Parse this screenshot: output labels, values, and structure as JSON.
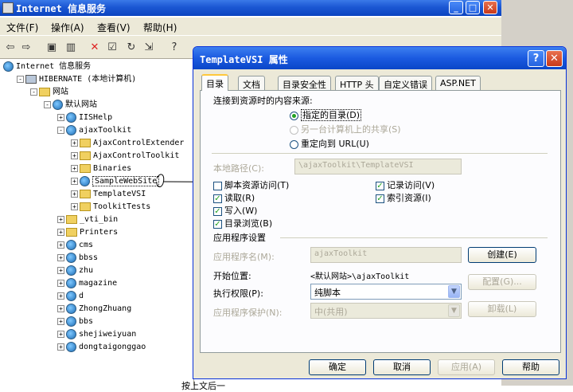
{
  "main_window": {
    "title": "Internet 信息服务",
    "menu": [
      "文件(F)",
      "操作(A)",
      "查看(V)",
      "帮助(H)"
    ]
  },
  "tree": [
    {
      "label": "Internet 信息服务",
      "icon": "iis-icon",
      "indent": 0,
      "exp": ""
    },
    {
      "label": "HIBERNATE (本地计算机)",
      "icon": "computer-icon",
      "indent": 1,
      "exp": "-"
    },
    {
      "label": "网站",
      "icon": "folder-icon",
      "indent": 2,
      "exp": "-"
    },
    {
      "label": "默认网站",
      "icon": "globe-icon",
      "indent": 3,
      "exp": "-"
    },
    {
      "label": "IISHelp",
      "icon": "globe-icon",
      "indent": 4,
      "exp": "+"
    },
    {
      "label": "ajaxToolkit",
      "icon": "globe-icon",
      "indent": 4,
      "exp": "-"
    },
    {
      "label": "AjaxControlExtender",
      "icon": "folder-icon",
      "indent": 5,
      "exp": "+"
    },
    {
      "label": "AjaxControlToolkit",
      "icon": "folder-icon",
      "indent": 5,
      "exp": "+"
    },
    {
      "label": "Binaries",
      "icon": "folder-icon",
      "indent": 5,
      "exp": "+"
    },
    {
      "label": "SampleWebSite",
      "icon": "globe-icon",
      "indent": 5,
      "exp": "+"
    },
    {
      "label": "TemplateVSI",
      "icon": "folder-icon",
      "indent": 5,
      "exp": "+"
    },
    {
      "label": "ToolkitTests",
      "icon": "folder-icon",
      "indent": 5,
      "exp": "+"
    },
    {
      "label": "_vti_bin",
      "icon": "folder-icon",
      "indent": 4,
      "exp": "+"
    },
    {
      "label": "Printers",
      "icon": "folder-icon",
      "indent": 4,
      "exp": "+"
    },
    {
      "label": "cms",
      "icon": "globe-icon",
      "indent": 4,
      "exp": "+"
    },
    {
      "label": "bbss",
      "icon": "globe-icon",
      "indent": 4,
      "exp": "+"
    },
    {
      "label": "zhu",
      "icon": "globe-icon",
      "indent": 4,
      "exp": "+"
    },
    {
      "label": "magazine",
      "icon": "globe-icon",
      "indent": 4,
      "exp": "+"
    },
    {
      "label": "d",
      "icon": "globe-icon",
      "indent": 4,
      "exp": "+"
    },
    {
      "label": "ZhongZhuang",
      "icon": "globe-icon",
      "indent": 4,
      "exp": "+"
    },
    {
      "label": "bbs",
      "icon": "globe-icon",
      "indent": 4,
      "exp": "+"
    },
    {
      "label": "shejiweiyuan",
      "icon": "globe-icon",
      "indent": 4,
      "exp": "+"
    },
    {
      "label": "dongtaigonggao",
      "icon": "globe-icon",
      "indent": 4,
      "exp": "+"
    }
  ],
  "dialog": {
    "title": "TemplateVSI 属性",
    "tabs": [
      "目录",
      "文档",
      "目录安全性",
      "HTTP 头",
      "自定义错误",
      "ASP.NET"
    ],
    "source_heading": "连接到资源时的内容来源:",
    "radio_dir": "指定的目录(D)",
    "radio_share": "另一台计算机上的共享(S)",
    "radio_url": "重定向到 URL(U)",
    "local_path_label": "本地路径(C):",
    "local_path_value": "\\ajaxToolkit\\TemplateVSI",
    "chk_script_source": "脚本资源访问(T)",
    "chk_read": "读取(R)",
    "chk_write": "写入(W)",
    "chk_browse": "目录浏览(B)",
    "chk_log": "记录访问(V)",
    "chk_index": "索引资源(I)",
    "app_settings": "应用程序设置",
    "app_name_label": "应用程序名(M):",
    "app_name_value": "ajaxToolkit",
    "start_label": "开始位置:",
    "start_value": "<默认网站>\\ajaxToolkit",
    "exec_label": "执行权限(P):",
    "exec_value": "纯脚本",
    "protect_label": "应用程序保护(N):",
    "protect_value": "中(共用)",
    "btn_create": "创建(E)",
    "btn_config": "配置(G)...",
    "btn_unload": "卸载(L)",
    "btn_ok": "确定",
    "btn_cancel": "取消",
    "btn_apply": "应用(A)",
    "btn_help": "帮助"
  },
  "bottom_text": "按上文后一"
}
